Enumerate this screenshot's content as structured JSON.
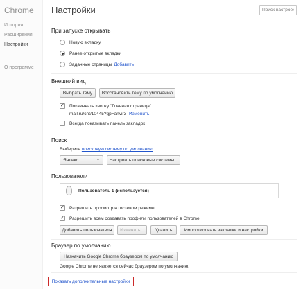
{
  "sidebar": {
    "brand": "Chrome",
    "items": [
      {
        "label": "История"
      },
      {
        "label": "Расширения"
      },
      {
        "label": "Настройки"
      },
      {
        "label": "О программе"
      }
    ]
  },
  "header": {
    "title": "Настройки",
    "search_placeholder": "Поиск настроек"
  },
  "startup": {
    "title": "При запуске открывать",
    "options": [
      {
        "label": "Новую вкладку",
        "selected": false
      },
      {
        "label": "Ранее открытые вкладки",
        "selected": true
      },
      {
        "label": "Заданные страницы",
        "selected": false
      }
    ],
    "add_link": "Добавить"
  },
  "appearance": {
    "title": "Внешний вид",
    "choose_theme": "Выбрать тему",
    "reset_theme": "Восстановить тему по умолчанию",
    "show_home": "Показывать кнопку \"Главная страница\"",
    "show_home_checked": true,
    "home_url": "mail.ru/cnt/10445?gp=anvir3",
    "change_link": "Изменить",
    "show_bookmarks": "Всегда показывать панель закладок",
    "show_bookmarks_checked": false
  },
  "search": {
    "title": "Поиск",
    "text_before": "Выберите",
    "link": "поисковую систему по умолчанию",
    "text_after": ".",
    "engine": "Яндекс",
    "configure": "Настроить поисковые системы..."
  },
  "users": {
    "title": "Пользователи",
    "current_user": "Пользователь 1 (используется)",
    "guest_mode": "Разрешить просмотр в гостевом режиме",
    "guest_checked": true,
    "create_profiles": "Разрешить всем создавать профили пользователей в Chrome",
    "create_checked": true,
    "add_user": "Добавить пользователя",
    "edit": "Изменить...",
    "delete": "Удалить",
    "import": "Импортировать закладки и настройки"
  },
  "default_browser": {
    "title": "Браузер по умолчанию",
    "make_default": "Назначить Google Chrome браузером по умолчанию",
    "status": "Google Chrome не является сейчас браузером по умолчанию."
  },
  "advanced_link": "Показать дополнительные настройки",
  "colors": {
    "link": "#2255cc",
    "highlight": "#cc2a2a"
  }
}
